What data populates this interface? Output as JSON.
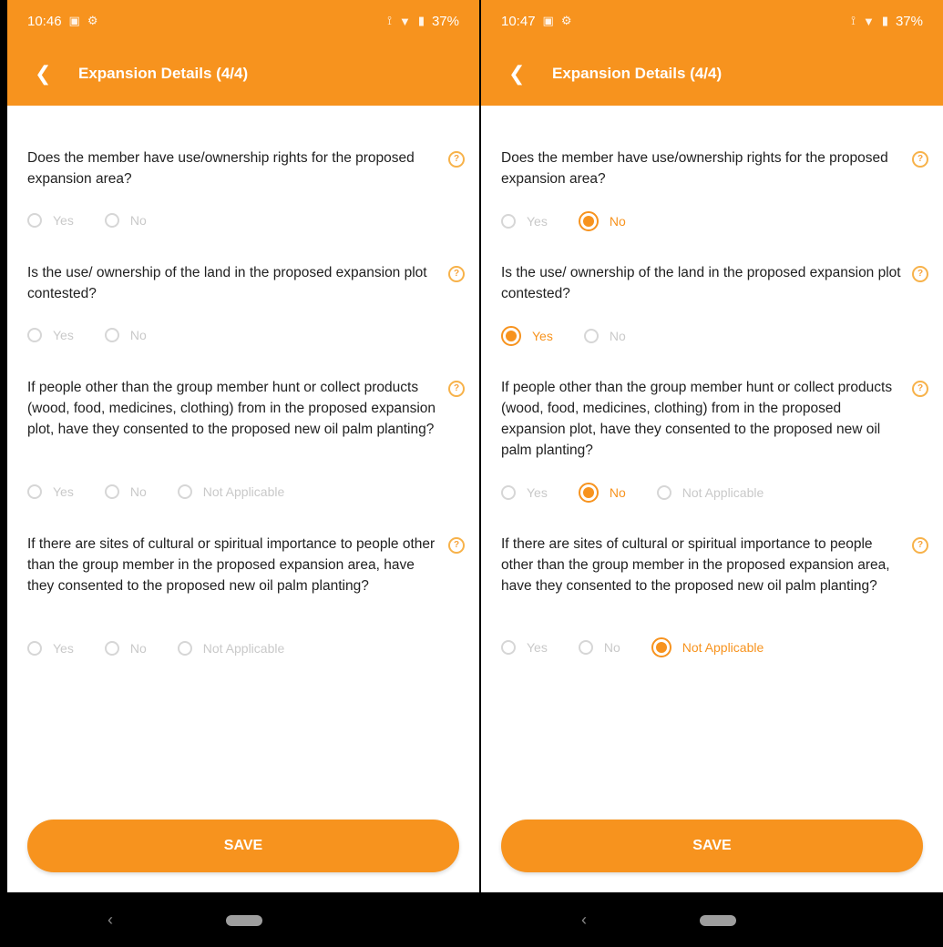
{
  "colors": {
    "accent": "#f7931e",
    "unselected": "#c9c9c9",
    "text": "#212121"
  },
  "screens": [
    {
      "status": {
        "time": "10:46",
        "battery": "37%",
        "icons_left": [
          "sim-icon",
          "settings-icon"
        ],
        "icons_right": [
          "vibrate-icon",
          "wifi-icon",
          "battery-icon"
        ]
      },
      "appbar": {
        "title": "Expansion Details (4/4)"
      },
      "questions": [
        {
          "text": "Does the member have use/ownership rights for the proposed expansion area?",
          "options": [
            "Yes",
            "No"
          ],
          "selected": null
        },
        {
          "text": "Is the use/ ownership of the land in the proposed expansion plot contested?",
          "options": [
            "Yes",
            "No"
          ],
          "selected": null
        },
        {
          "text": "If people other than the group member hunt or collect products (wood, food, medicines, clothing) from in the proposed expansion plot, have they consented to the proposed new oil palm planting?",
          "options": [
            "Yes",
            "No",
            "Not Applicable"
          ],
          "selected": null
        },
        {
          "text": "If there are sites of cultural or spiritual importance to people other than the group member in the proposed expansion area, have they consented to the proposed new oil palm planting?",
          "options": [
            "Yes",
            "No",
            "Not Applicable"
          ],
          "selected": null
        }
      ],
      "save_label": "SAVE"
    },
    {
      "status": {
        "time": "10:47",
        "battery": "37%",
        "icons_left": [
          "sim-icon",
          "settings-icon"
        ],
        "icons_right": [
          "vibrate-icon",
          "wifi-icon",
          "battery-icon"
        ]
      },
      "appbar": {
        "title": "Expansion Details (4/4)"
      },
      "questions": [
        {
          "text": "Does the member have use/ownership rights for the proposed expansion area?",
          "options": [
            "Yes",
            "No"
          ],
          "selected": "No"
        },
        {
          "text": "Is the use/ ownership of the land in the proposed expansion plot contested?",
          "options": [
            "Yes",
            "No"
          ],
          "selected": "Yes"
        },
        {
          "text": "If people other than the group member hunt or collect products (wood, food, medicines, clothing) from in the proposed expansion plot, have they consented to the proposed new oil palm planting?",
          "options": [
            "Yes",
            "No",
            "Not Applicable"
          ],
          "selected": "No"
        },
        {
          "text": "If there are sites of cultural or spiritual importance to people other than the group member in the proposed expansion area, have they consented to the proposed new oil palm planting?",
          "options": [
            "Yes",
            "No",
            "Not Applicable"
          ],
          "selected": "Not Applicable"
        }
      ],
      "save_label": "SAVE"
    }
  ]
}
